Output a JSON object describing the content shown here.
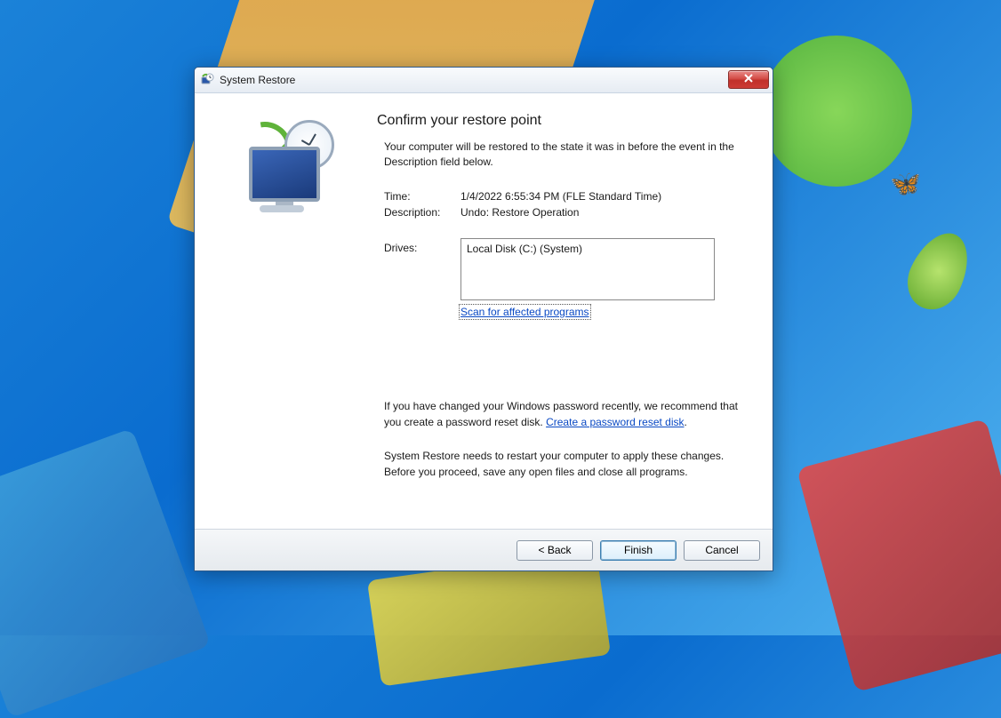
{
  "window": {
    "title": "System Restore"
  },
  "content": {
    "heading": "Confirm your restore point",
    "intro": "Your computer will be restored to the state it was in before the event in the Description field below.",
    "time_label": "Time:",
    "time_value": "1/4/2022 6:55:34 PM (FLE Standard Time)",
    "description_label": "Description:",
    "description_value": "Undo: Restore Operation",
    "drives_label": "Drives:",
    "drives_value": "Local Disk (C:) (System)",
    "scan_link": "Scan for affected programs",
    "password_note_pre": "If you have changed your Windows password recently, we recommend that you create a password reset disk. ",
    "password_link": "Create a password reset disk",
    "password_note_post": ".",
    "restart_note": "System Restore needs to restart your computer to apply these changes. Before you proceed, save any open files and close all programs."
  },
  "footer": {
    "back": "< Back",
    "finish": "Finish",
    "cancel": "Cancel"
  }
}
